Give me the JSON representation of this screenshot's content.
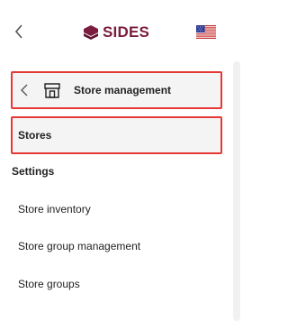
{
  "header": {
    "brand_name": "SIDES",
    "back_icon": "chevron-left-icon",
    "logo_icon": "brand-mark-icon",
    "flag_icon": "us-flag-icon",
    "brand_color": "#7a1d3e"
  },
  "menu": {
    "section": {
      "label": "Store management",
      "back_icon": "chevron-left-icon",
      "icon": "storefront-icon"
    },
    "active_item": {
      "label": "Stores"
    },
    "group_heading": "Settings",
    "items": [
      {
        "label": "Store inventory"
      },
      {
        "label": "Store group management"
      },
      {
        "label": "Store groups"
      }
    ],
    "highlight_color": "#e53935"
  }
}
